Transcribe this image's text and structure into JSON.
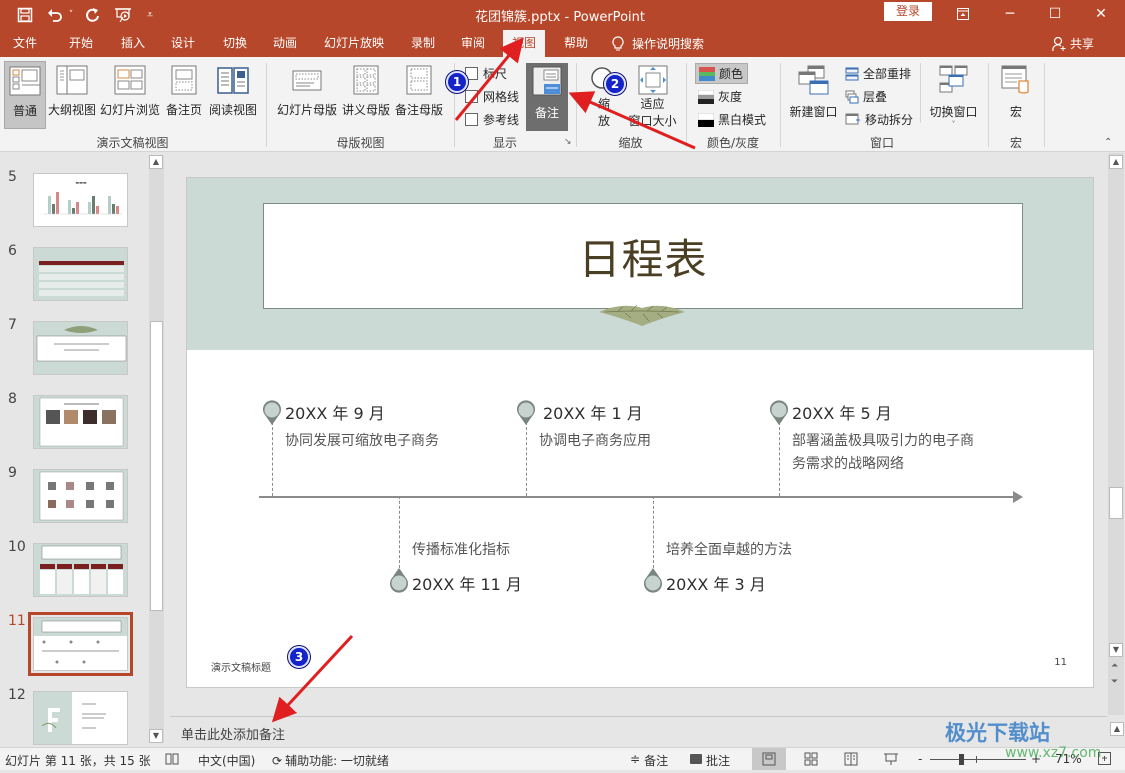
{
  "window": {
    "title": "花团锦簇.pptx  -  PowerPoint",
    "login_label": "登录",
    "controls": [
      "ribbon-display-icon",
      "minimize-icon",
      "maximize-icon",
      "close-icon"
    ]
  },
  "quick_access": [
    "save-icon",
    "undo-icon",
    "redo-icon",
    "present-from-start-icon",
    "customize-icon"
  ],
  "tabs": [
    {
      "label": "文件"
    },
    {
      "label": "开始"
    },
    {
      "label": "插入"
    },
    {
      "label": "设计"
    },
    {
      "label": "切换"
    },
    {
      "label": "动画"
    },
    {
      "label": "幻灯片放映"
    },
    {
      "label": "录制"
    },
    {
      "label": "审阅"
    },
    {
      "label": "视图",
      "active": true
    },
    {
      "label": "帮助"
    }
  ],
  "tell_me": "操作说明搜索",
  "share_label": "共享",
  "ribbon": {
    "groups": {
      "presentation_views": {
        "label": "演示文稿视图",
        "buttons": [
          {
            "label": "普通",
            "selected": true
          },
          {
            "label": "大纲视图"
          },
          {
            "label": "幻灯片浏览"
          },
          {
            "label": "备注页"
          },
          {
            "label": "阅读视图"
          }
        ]
      },
      "master_views": {
        "label": "母版视图",
        "buttons": [
          {
            "label": "幻灯片母版"
          },
          {
            "label": "讲义母版"
          },
          {
            "label": "备注母版"
          }
        ]
      },
      "show": {
        "label": "显示",
        "checkboxes": [
          {
            "label": "标尺",
            "checked": false
          },
          {
            "label": "网格线",
            "checked": false
          },
          {
            "label": "参考线",
            "checked": false
          }
        ],
        "notes_button": {
          "label": "备注",
          "selected": true
        }
      },
      "zoom": {
        "label": "缩放",
        "buttons": [
          {
            "label": "缩放"
          },
          {
            "label": "适应窗口大小"
          }
        ],
        "zoom_label_line1": "缩",
        "zoom_label_line2": "放",
        "fit_label_line1": "适应",
        "fit_label_line2": "窗口大小"
      },
      "color": {
        "label": "颜色/灰度",
        "options": [
          {
            "label": "颜色",
            "selected": true
          },
          {
            "label": "灰度"
          },
          {
            "label": "黑白模式"
          }
        ]
      },
      "window": {
        "label": "窗口",
        "new_window": "新建窗口",
        "small": [
          {
            "label": "全部重排"
          },
          {
            "label": "层叠"
          },
          {
            "label": "移动拆分"
          }
        ],
        "switch_window": "切换窗口"
      },
      "macros": {
        "label": "宏",
        "button": "宏"
      }
    }
  },
  "annotations": {
    "badge1": "1",
    "badge2": "2",
    "badge3": "3"
  },
  "thumbnails": [
    {
      "number": "5",
      "desc": "chart slide"
    },
    {
      "number": "6",
      "desc": "table slide"
    },
    {
      "number": "7",
      "desc": "quote slide"
    },
    {
      "number": "8",
      "desc": "team slide"
    },
    {
      "number": "9",
      "desc": "team grid slide"
    },
    {
      "number": "10",
      "desc": "product table slide"
    },
    {
      "number": "11",
      "desc": "timeline slide",
      "selected": true
    },
    {
      "number": "12",
      "desc": "contact slide"
    }
  ],
  "slide": {
    "title": "日程表",
    "footer_left": "演示文稿标题",
    "page_number": "11",
    "timeline": [
      {
        "date": "20XX 年 9 月",
        "desc": "协同发展可缩放电子商务",
        "position": "top"
      },
      {
        "date": "20XX 年 11 月",
        "desc": "传播标准化指标",
        "position": "bottom"
      },
      {
        "date": "20XX 年 1 月",
        "desc": "协调电子商务应用",
        "position": "top"
      },
      {
        "date": "20XX 年 3 月",
        "desc": "培养全面卓越的方法",
        "position": "bottom"
      },
      {
        "date": "20XX 年 5 月",
        "desc_line1": "部署涵盖极具吸引力的电子商",
        "desc_line2": "务需求的战略网络",
        "position": "top"
      }
    ]
  },
  "notes": {
    "placeholder": "单击此处添加备注"
  },
  "status": {
    "slide_info": "幻灯片 第 11 张，共 15 张",
    "language": "中文(中国)",
    "accessibility": "辅助功能: 一切就绪",
    "notes_label": "备注",
    "comments_label": "批注",
    "zoom_minus": "-",
    "zoom_plus": "+",
    "zoom_level": "71%",
    "zoom_fraction": 0.71
  },
  "watermark": {
    "text": "极光下载站",
    "url_text": "www.xz7.com"
  },
  "colors": {
    "accent": "#b7472a",
    "slide_head": "#ccdad6",
    "title_text": "#4a3e23",
    "badge": "#1424c8",
    "arrow": "#e02020"
  }
}
